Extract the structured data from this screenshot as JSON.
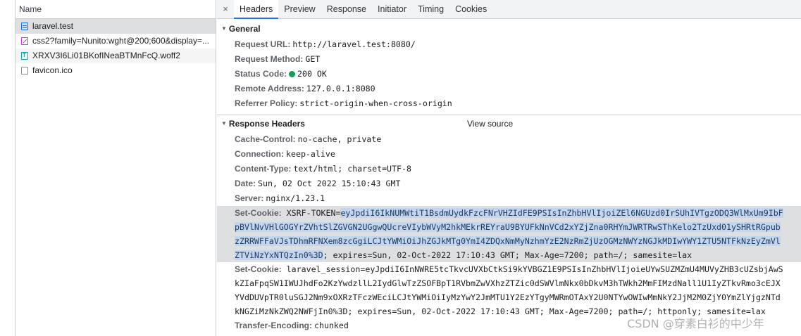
{
  "request_list": {
    "header": "Name",
    "items": [
      {
        "name": "laravel.test",
        "icon": "document-icon"
      },
      {
        "name": "css2?family=Nunito:wght@200;600&display=...",
        "icon": "stylesheet-icon"
      },
      {
        "name": "XRXV3I6Li01BKofINeaBTMnFcQ.woff2",
        "icon": "font-icon"
      },
      {
        "name": "favicon.ico",
        "icon": "file-icon"
      }
    ]
  },
  "tabs": {
    "close": "×",
    "items": [
      "Headers",
      "Preview",
      "Response",
      "Initiator",
      "Timing",
      "Cookies"
    ],
    "active": "Headers"
  },
  "general": {
    "title": "General",
    "request_url_key": "Request URL:",
    "request_url": "http://laravel.test:8080/",
    "request_method_key": "Request Method:",
    "request_method": "GET",
    "status_code_key": "Status Code:",
    "status_code": "200 OK",
    "remote_address_key": "Remote Address:",
    "remote_address": "127.0.0.1:8080",
    "referrer_policy_key": "Referrer Policy:",
    "referrer_policy": "strict-origin-when-cross-origin"
  },
  "response_headers": {
    "title": "Response Headers",
    "view_source": "View source",
    "cache_control_key": "Cache-Control:",
    "cache_control": "no-cache, private",
    "connection_key": "Connection:",
    "connection": "keep-alive",
    "content_type_key": "Content-Type:",
    "content_type": "text/html; charset=UTF-8",
    "date_key": "Date:",
    "date": "Sun, 02 Oct 2022 15:10:43 GMT",
    "server_key": "Server:",
    "server": "nginx/1.23.1",
    "set_cookie_key": "Set-Cookie:",
    "xsrf_prefix": "XSRF-TOKEN=",
    "xsrf_lines": [
      "eyJpdiI6IkNUMWtiT1BsdmUydkFzcFNrVHZIdFE9PSIsInZhbHVlIjoiZEl6NGUzd0IrSUhIVTgzODQ3WlMxUm9IbF",
      "pBVlNvVHlGOGYrZVhtSlZGVGN2UGgwQUcreVIybWVyM2hkMEkrREYraU9BYUFkNnVCd2xYZjZna0RHYmJWRTRwSThKelo2TzUxd01ySHRtRGpub",
      "zZRRWFFaVJsTDhmRFNXem8zcGgiLCJtYWMiOiJhZGJkMTg0YmI4ZDQxNmMyNzhmYzE2NzRmZjUzOGMzNWYzNGJkMDIwYWY1ZTU5NTFkNzEyZmVl",
      "ZTViNzYxNTQzIn0%3D"
    ],
    "xsrf_tail": "; expires=Sun, 02-Oct-2022 17:10:43 GMT; Max-Age=7200; path=/; samesite=lax",
    "session_lines": [
      "laravel_session=eyJpdiI6InNWRE5tcTkvcUVXbCtkSi9kYVBGZ1E9PSIsInZhbHVlIjoieUYwSUZMZmU4MUVyZHB3cUZsbjAwS",
      "kZIaFpqSW1IWUJhdFo2KzYwdzllL2IydGlwTzZSOFBpT1RVbmZwVXhzZTZic0dSWVlmNkx0bDkvM3hTWkh2MmFIMzdNall1U1IyZTkvRmo3cEJX",
      "YVdDUVpTR0luSGJ2Nm9xOXRzTFczWEciLCJtYWMiOiIyMzYwY2JmMTU1Y2EzYTgyMWRmOTAxY2U0NTYwOWIwMmNkY2JjM2M0ZjY0YmZlYjgzNTd",
      "kNGZiMzNkZWQ2NWFjIn0%3D; expires=Sun, 02-Oct-2022 17:10:43 GMT; Max-Age=7200; path=/; httponly; samesite=lax"
    ],
    "transfer_encoding_key": "Transfer-Encoding:",
    "transfer_encoding": "chunked"
  },
  "watermark": "CSDN @穿素白衫的中少年",
  "colors": {
    "selection_highlight": "#c3d6ee",
    "selected_row": "#dedfe1",
    "status_ok": "#0f9d58",
    "active_tab_underline": "#1a73e8"
  }
}
